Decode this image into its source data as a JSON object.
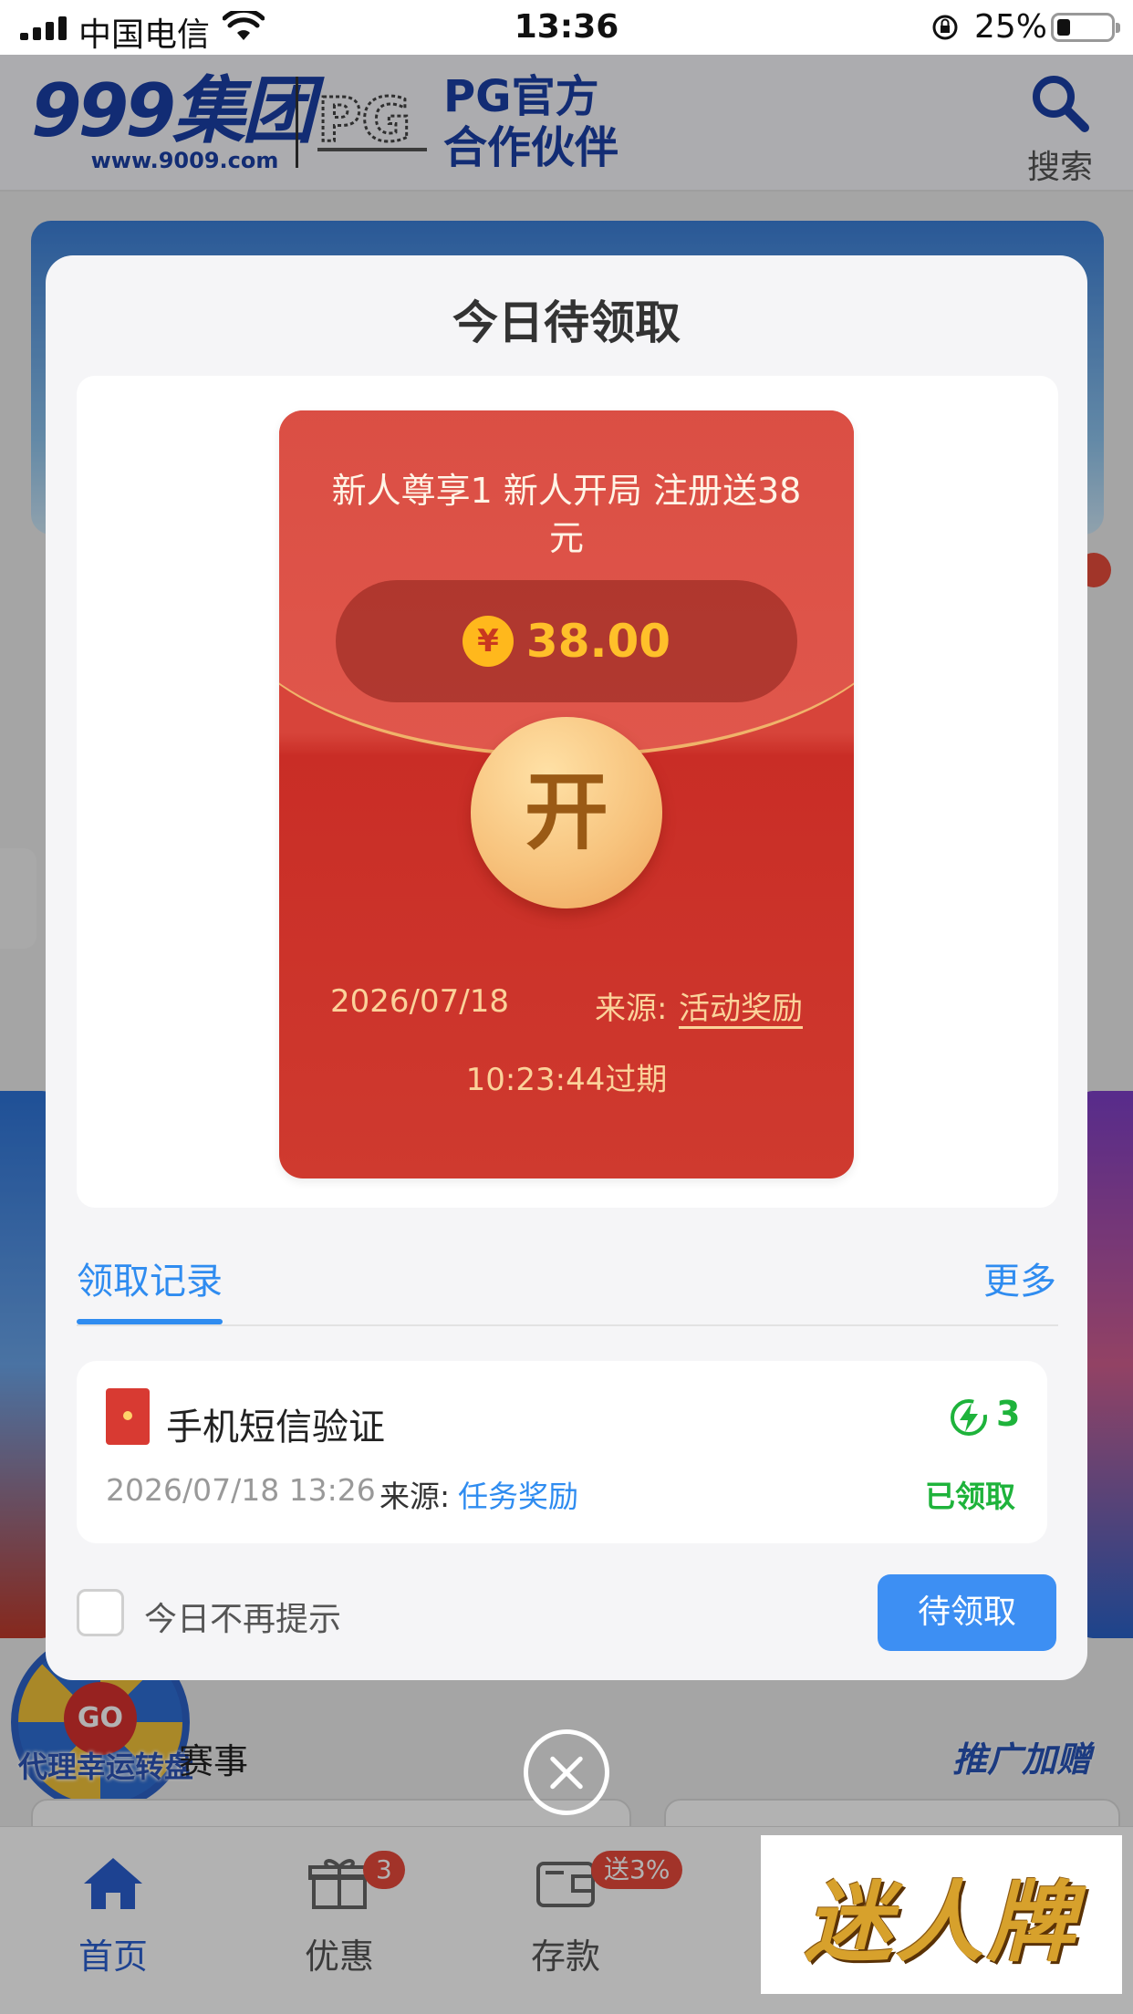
{
  "status_bar": {
    "carrier": "中国电信",
    "time": "13:36",
    "battery": "25%"
  },
  "header": {
    "logo_main": "999集团",
    "logo_url": "www.9009.com",
    "partner_line1": "PG官方",
    "partner_line2": "合作伙伴",
    "search_label": "搜索"
  },
  "background": {
    "wheel_go": "GO",
    "wheel_label": "代理幸运转盘",
    "section_partial": "赛事",
    "promo_right": "推广加赠"
  },
  "tabbar": {
    "items": [
      {
        "label": "首页",
        "icon": "home-icon"
      },
      {
        "label": "优惠",
        "icon": "gift-icon",
        "badge": "3"
      },
      {
        "label": "存款",
        "icon": "wallet-icon",
        "badge": "送3%"
      }
    ]
  },
  "modal": {
    "title": "今日待领取",
    "envelope": {
      "title": "新人尊享1 新人开局 注册送38元",
      "currency_symbol": "¥",
      "amount": "38.00",
      "open_label": "开",
      "date": "2026/07/18",
      "source_label": "来源:",
      "source_value": "活动奖励",
      "expire": "10:23:44过期"
    },
    "records_tab": "领取记录",
    "more": "更多",
    "record": {
      "title": "手机短信验证",
      "count": "3",
      "datetime": "2026/07/18 13:26",
      "source_label": "来源:",
      "source_value": "任务奖励",
      "status": "已领取"
    },
    "dont_remind": "今日不再提示",
    "pending_button": "待领取"
  },
  "watermark": "迷人牌",
  "colors": {
    "accent_blue": "#2f8cf0",
    "envelope_red": "#d7443a",
    "success_green": "#1eb33b",
    "brand_navy": "#1b3fa6"
  }
}
